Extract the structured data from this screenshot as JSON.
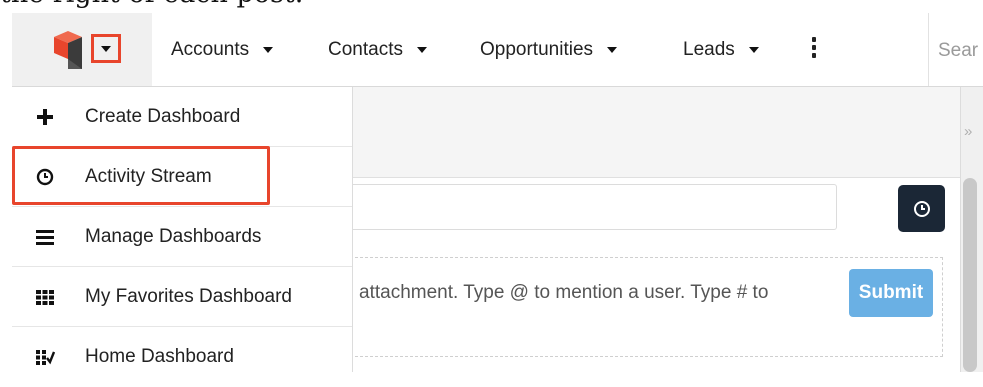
{
  "document": {
    "caption_fragment": "the right of each post."
  },
  "topbar": {
    "logo_alt": "Sugar cube logo",
    "nav": [
      {
        "label": "Accounts"
      },
      {
        "label": "Contacts"
      },
      {
        "label": "Opportunities"
      },
      {
        "label": "Leads"
      }
    ],
    "more_icon": "kebab-icon",
    "search_placeholder": "Sear"
  },
  "menu": {
    "items": [
      {
        "label": "Create Dashboard",
        "icon": "plus-icon"
      },
      {
        "label": "Activity Stream",
        "icon": "clock-icon",
        "highlighted": true
      },
      {
        "label": "Manage Dashboards",
        "icon": "menu-lines-icon"
      },
      {
        "label": "My Favorites Dashboard",
        "icon": "grid-icon"
      },
      {
        "label": "Home Dashboard",
        "icon": "grid-check-icon"
      }
    ]
  },
  "activity": {
    "post_placeholder": "attachment. Type @ to mention a user. Type # to",
    "submit_label": "Submit",
    "rail_arrow": "»"
  },
  "colors": {
    "highlight": "#e8452c",
    "submit": "#6ab0e4",
    "clock_button": "#1b2736",
    "logo_red": "#e8452c"
  }
}
